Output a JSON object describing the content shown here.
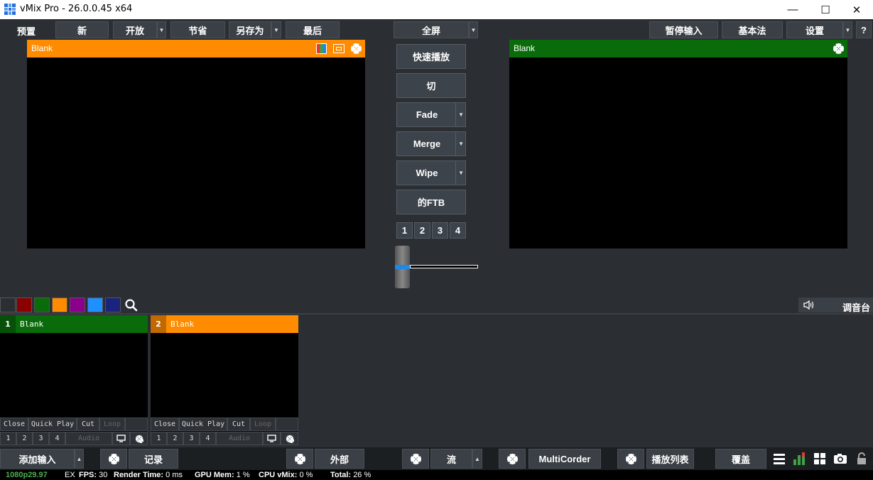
{
  "window": {
    "title": "vMix Pro - 26.0.0.45 x64",
    "minimize": "—",
    "maximize": "☐",
    "close": "✕"
  },
  "toolbar": {
    "preview_label": "预置",
    "new": "新",
    "open": "开放",
    "save": "节省",
    "save_as": "另存为",
    "last": "最后",
    "fullscreen": "全屏",
    "pause_input": "暂停输入",
    "basic": "基本法",
    "settings": "设置",
    "help": "?"
  },
  "preview": {
    "title": "Blank",
    "color": "#ff8c00"
  },
  "output": {
    "title": "Blank",
    "color": "#0a6b0a"
  },
  "transitions": {
    "quick_play": "快速播放",
    "cut": "切",
    "fade": "Fade",
    "merge": "Merge",
    "wipe": "Wipe",
    "ftb": "的FTB",
    "numbers": [
      "1",
      "2",
      "3",
      "4"
    ]
  },
  "filter_colors": [
    "#8b0000",
    "#0a6b0a",
    "#ff8c00",
    "#8b008b",
    "#1e90ff",
    "#1a237e"
  ],
  "mixer_label": "调音台",
  "inputs": [
    {
      "number": "1",
      "title": "Blank",
      "color": "#0a6b0a",
      "controls": [
        "Close",
        "Quick Play",
        "Cut",
        "Loop"
      ],
      "overlays": [
        "1",
        "2",
        "3",
        "4"
      ],
      "audio": "Audio"
    },
    {
      "number": "2",
      "title": "Blank",
      "color": "#ff8c00",
      "controls": [
        "Close",
        "Quick Play",
        "Cut",
        "Loop"
      ],
      "overlays": [
        "1",
        "2",
        "3",
        "4"
      ],
      "audio": "Audio"
    }
  ],
  "bottom": {
    "add_input": "添加输入",
    "record": "记录",
    "external": "外部",
    "stream": "流",
    "multicorder": "MultiCorder",
    "playlist": "播放列表",
    "overlay": "覆盖"
  },
  "status": {
    "format": "1080p29.97",
    "ex": "EX",
    "fps_label": "FPS:",
    "fps": "30",
    "render_label": "Render Time:",
    "render": "0 ms",
    "gpu_label": "GPU Mem:",
    "gpu": "1 %",
    "cpu_label": "CPU vMix:",
    "cpu": "0 %",
    "total_label": "Total:",
    "total": "26 %"
  }
}
